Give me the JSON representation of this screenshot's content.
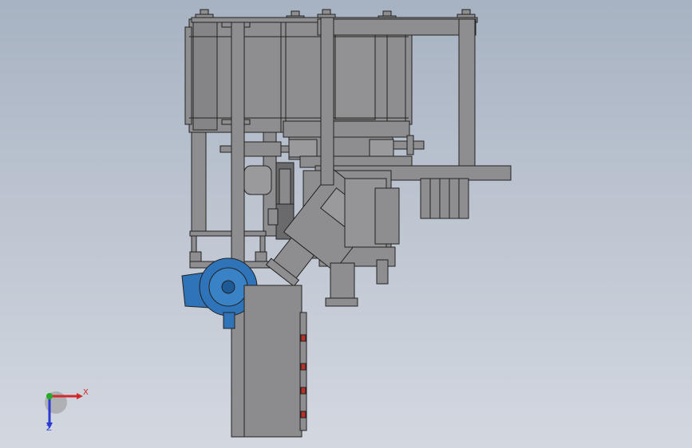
{
  "viewport": {
    "background_top": "#a7b2c2",
    "background_bottom": "#d3d8e0"
  },
  "model": {
    "body_color": "#8e8e90",
    "edge_color": "#222222",
    "motor_color": "#2f73b8",
    "control_box_color": "#8c8c8e",
    "indicator_color": "#b7312b"
  },
  "triad": {
    "x_label": "X",
    "y_label": "Y",
    "z_label": "Z",
    "x_color": "#d22a2a",
    "y_color": "#2aa82a",
    "z_color": "#2a3ad2"
  }
}
